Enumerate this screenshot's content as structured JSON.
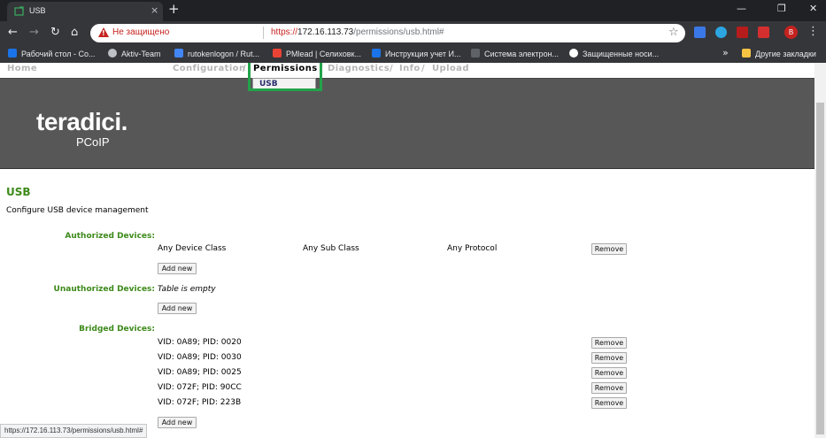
{
  "browser": {
    "tab_title": "USB",
    "tab_close": "×",
    "new_tab": "+",
    "window_controls": [
      "—",
      "❐",
      "✕"
    ],
    "insecure_label": "Не защищено",
    "url_scheme": "https://",
    "url_host": "172.16.113.73",
    "url_path": "/permissions/usb.html#",
    "avatar_letter": "B",
    "bookmarks": [
      {
        "label": "Рабочий стол - Со...",
        "color": "#1a73e8"
      },
      {
        "label": "Aktiv-Team",
        "color": "#bdc1c6"
      },
      {
        "label": "rutokenlogon / Rut...",
        "color": "#4285f4"
      },
      {
        "label": "PMlead | Селиховк...",
        "color": "#ea4335"
      },
      {
        "label": "Инструкция учет И...",
        "color": "#1a73e8"
      },
      {
        "label": "Система электрон...",
        "color": "#5f6368"
      },
      {
        "label": "Защищенные носи...",
        "color": "#ffffff"
      }
    ],
    "bookmarks_more": "»",
    "other_bookmarks": "Другие закладки",
    "status_url": "https://172.16.113.73/permissions/usb.html#"
  },
  "nav": {
    "home": "Home",
    "configuration": "Configuration",
    "separator": "/",
    "permissions": "Permissions",
    "diagnostics": "Diagnostics",
    "info": "Info",
    "upload": "Upload",
    "submenu_usb": "USB"
  },
  "brand": {
    "logo": "teradici.",
    "sub": "PCoIP"
  },
  "page": {
    "title": "USB",
    "description": "Configure USB device management"
  },
  "authorized": {
    "label": "Authorized Devices:",
    "rows": [
      {
        "device_class": "Any Device Class",
        "sub_class": "Any Sub Class",
        "protocol": "Any Protocol"
      }
    ]
  },
  "unauthorized": {
    "label": "Unauthorized Devices:",
    "empty": "Table is empty"
  },
  "bridged": {
    "label": "Bridged Devices:",
    "rows": [
      "VID: 0A89; PID: 0020",
      "VID: 0A89; PID: 0030",
      "VID: 0A89; PID: 0025",
      "VID: 072F; PID: 90CC",
      "VID: 072F; PID: 223B"
    ]
  },
  "buttons": {
    "remove": "Remove",
    "add_new": "Add new"
  },
  "colors": {
    "accent_green": "#3d8a1a",
    "highlight_box": "#22a34a",
    "banner": "#575757"
  }
}
